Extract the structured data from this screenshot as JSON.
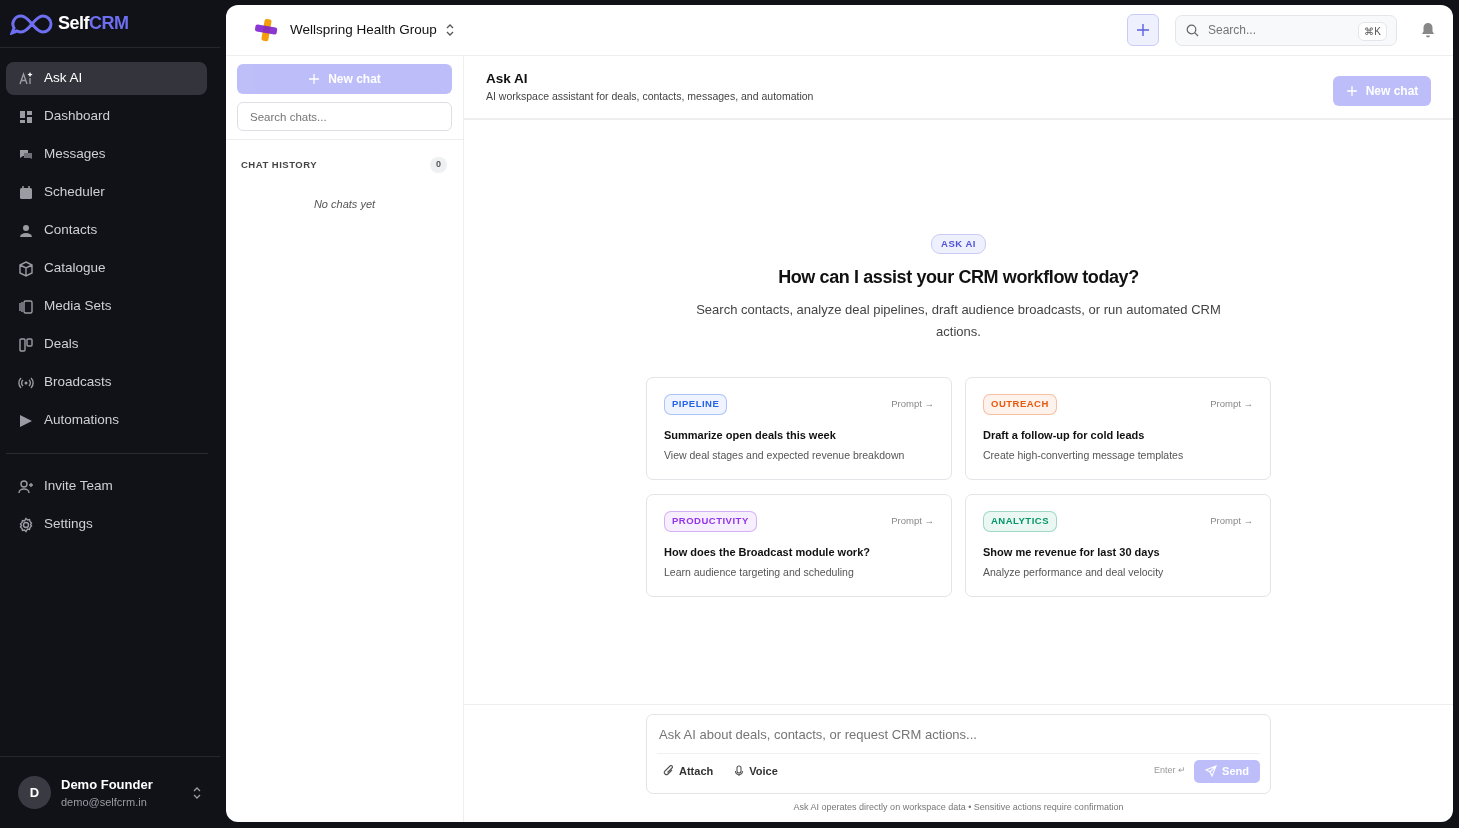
{
  "brand": {
    "first": "Self",
    "second": "CRM"
  },
  "nav": [
    {
      "label": "Ask AI",
      "selected": true
    },
    {
      "label": "Dashboard",
      "selected": false
    },
    {
      "label": "Messages",
      "selected": false
    },
    {
      "label": "Scheduler",
      "selected": false
    },
    {
      "label": "Contacts",
      "selected": false
    },
    {
      "label": "Catalogue",
      "selected": false
    },
    {
      "label": "Media Sets",
      "selected": false
    },
    {
      "label": "Deals",
      "selected": false
    },
    {
      "label": "Broadcasts",
      "selected": false
    },
    {
      "label": "Automations",
      "selected": false
    }
  ],
  "nav_bottom": [
    {
      "label": "Invite Team",
      "selected": false
    },
    {
      "label": "Settings",
      "selected": false
    }
  ],
  "user": {
    "initial": "D",
    "name": "Demo Founder",
    "email": "demo@selfcrm.in"
  },
  "workspace": {
    "name": "Wellspring Health Group"
  },
  "topbar": {
    "search_placeholder": "Search...",
    "shortcut": "⌘K"
  },
  "chat_panel": {
    "new_chat": {
      "label": "New chat",
      "disabled": true
    },
    "search_placeholder": "Search chats...",
    "history_title": "CHAT HISTORY",
    "history_count": "0",
    "empty": "No chats yet"
  },
  "header": {
    "title": "Ask AI",
    "subtitle": "AI workspace assistant for deals, contacts, messages, and automation",
    "new_chat": {
      "label": "New chat",
      "disabled": true
    }
  },
  "hero": {
    "badge": "ASK AI",
    "title": "How can I assist your CRM workflow today?",
    "text": "Search contacts, analyze deal pipelines, draft audience broadcasts, or run automated CRM actions."
  },
  "prompts": [
    {
      "tag": "PIPELINE",
      "color": "#2563eb",
      "hint": "Prompt →",
      "title": "Summarize open deals this week",
      "text": "View deal stages and expected revenue breakdown"
    },
    {
      "tag": "OUTREACH",
      "color": "#ea580c",
      "hint": "Prompt →",
      "title": "Draft a follow-up for cold leads",
      "text": "Create high-converting message templates"
    },
    {
      "tag": "PRODUCTIVITY",
      "color": "#9333ea",
      "hint": "Prompt →",
      "title": "How does the Broadcast module work?",
      "text": "Learn audience targeting and scheduling"
    },
    {
      "tag": "ANALYTICS",
      "color": "#059669",
      "hint": "Prompt →",
      "title": "Show me revenue for last 30 days",
      "text": "Analyze performance and deal velocity"
    }
  ],
  "composer": {
    "placeholder": "Ask AI about deals, contacts, or request CRM actions...",
    "attach": "Attach",
    "voice": "Voice",
    "enter_hint": "Enter ↵",
    "send": {
      "label": "Send",
      "disabled": true
    },
    "footnote": "Ask AI operates directly on workspace data • Sensitive actions require confirmation"
  }
}
